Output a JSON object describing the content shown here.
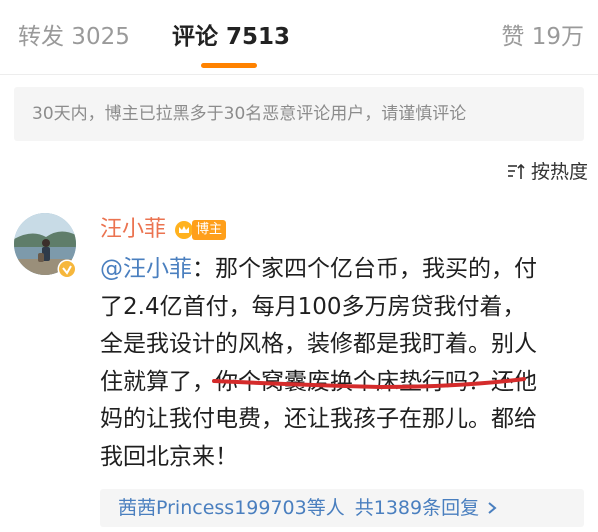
{
  "tabs": {
    "reposts": "转发 3025",
    "comments": "评论 7513",
    "likes": "赞 19万"
  },
  "notice": "30天内，博主已拉黑多于30名恶意评论用户，请谨慎评论",
  "sort": {
    "label": "按热度",
    "icon": "sort-icon"
  },
  "comment": {
    "author": "汪小菲",
    "badge": "博主",
    "lines": {
      "l1_mention": "@汪小菲",
      "l1_rest": "：那个家四个亿台币，我买的，付",
      "l2": "了2.4亿首付，每月100多万房贷我付着，",
      "l3": "全是我设计的风格，装修都是我盯着。别人",
      "l4": "住就算了，你个窝囊废换个床垫行吗？还他",
      "l5": "妈的让我付电费，还让我孩子在那儿。都给",
      "l6": "我回北京来！"
    }
  },
  "replies": {
    "user": "茜茜Princess199703",
    "suffix": "等人",
    "count": "共1389条回复"
  },
  "colors": {
    "accent": "#ff8200",
    "author": "#eb7350",
    "link": "#4a7fbf",
    "underline": "#d42b2b"
  }
}
